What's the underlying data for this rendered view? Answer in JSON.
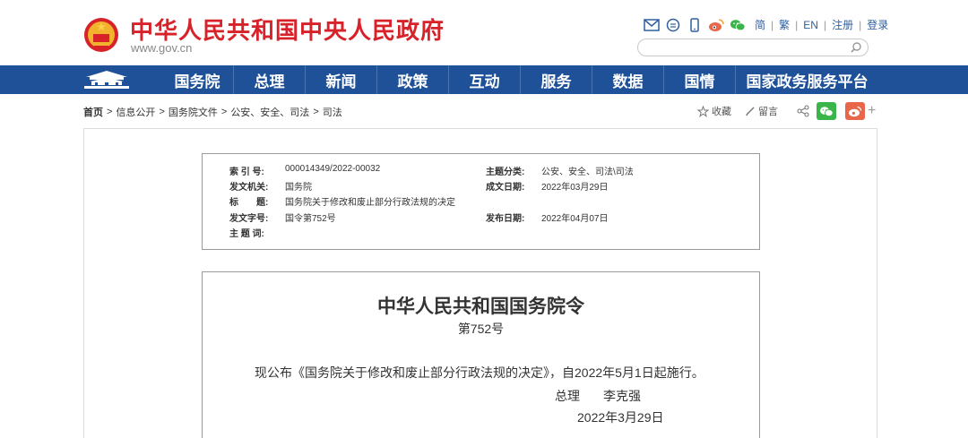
{
  "header": {
    "site_title": "中华人民共和国中央人民政府",
    "site_domain": "www.gov.cn",
    "top_links": [
      "简",
      "繁",
      "EN",
      "注册",
      "登录"
    ],
    "search": {
      "placeholder": ""
    }
  },
  "nav": {
    "items": [
      "国务院",
      "总理",
      "新闻",
      "政策",
      "互动",
      "服务",
      "数据",
      "国情",
      "国家政务服务平台"
    ]
  },
  "breadcrumb": {
    "home": "首页",
    "items": [
      "信息公开",
      "国务院文件",
      "公安、安全、司法",
      "司法"
    ]
  },
  "tools": {
    "favorite": "收藏",
    "comment": "留言",
    "more": "+"
  },
  "meta": {
    "index_label": "索 引 号:",
    "index_value": "000014349/2022-00032",
    "category_label": "主题分类:",
    "category_value": "公安、安全、司法\\司法",
    "issuer_label": "发文机关:",
    "issuer_value": "国务院",
    "created_label": "成文日期:",
    "created_value": "2022年03月29日",
    "title_label": "标　　题:",
    "title_value": "国务院关于修改和废止部分行政法规的决定",
    "docno_label": "发文字号:",
    "docno_value": "国令第752号",
    "published_label": "发布日期:",
    "published_value": "2022年04月07日",
    "keywords_label": "主 题 词:",
    "keywords_value": ""
  },
  "document": {
    "title": "中华人民共和国国务院令",
    "number": "第752号",
    "body": "现公布《国务院关于修改和废止部分行政法规的决定》，自2022年5月1日起施行。",
    "signer_title": "总理",
    "signer_name": "李克强",
    "date": "2022年3月29日"
  },
  "colors": {
    "brand_red": "#d8222a",
    "nav_blue": "#1f5199",
    "link_blue": "#2f5f9e",
    "wechat_green": "#3ab54a",
    "weibo_orange": "#e8674a"
  }
}
